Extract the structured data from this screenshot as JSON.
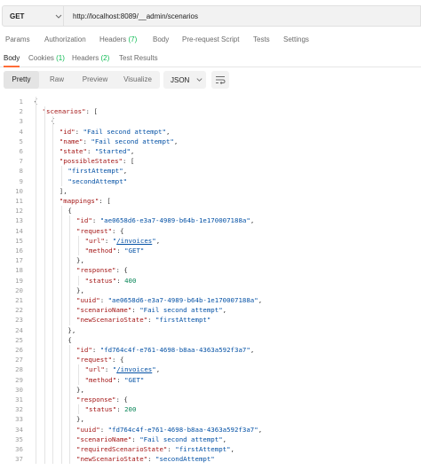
{
  "request": {
    "method": "GET",
    "url": "http://localhost:8089/__admin/scenarios"
  },
  "request_tabs": [
    {
      "label": "Params",
      "count": ""
    },
    {
      "label": "Authorization",
      "count": ""
    },
    {
      "label": "Headers",
      "count": "(7)"
    },
    {
      "label": "Body",
      "count": ""
    },
    {
      "label": "Pre-request Script",
      "count": ""
    },
    {
      "label": "Tests",
      "count": ""
    },
    {
      "label": "Settings",
      "count": ""
    }
  ],
  "response_tabs": [
    {
      "label": "Body",
      "count": "",
      "active": true
    },
    {
      "label": "Cookies",
      "count": "(1)",
      "active": false
    },
    {
      "label": "Headers",
      "count": "(2)",
      "active": false
    },
    {
      "label": "Test Results",
      "count": "",
      "active": false
    }
  ],
  "view_modes": [
    "Pretty",
    "Raw",
    "Preview",
    "Visualize"
  ],
  "active_view_mode": "Pretty",
  "format": "JSON",
  "icons": {
    "method_dropdown": "chevron-down-icon",
    "format_dropdown": "chevron-down-icon",
    "wrap": "wrap-lines-icon"
  },
  "colors": {
    "accent": "#ff6c37",
    "count": "#0cbb52",
    "key": "#a31515",
    "string": "#0451a5",
    "number": "#098658"
  },
  "code_lines": [
    [
      {
        "t": "p",
        "v": "{"
      }
    ],
    [
      {
        "t": "k",
        "v": "\"scenarios\""
      },
      {
        "t": "p",
        "v": ": ["
      }
    ],
    [
      {
        "t": "p",
        "v": "{"
      }
    ],
    [
      {
        "t": "k",
        "v": "\"id\""
      },
      {
        "t": "p",
        "v": ": "
      },
      {
        "t": "s",
        "v": "\"Fail second attempt\""
      },
      {
        "t": "p",
        "v": ","
      }
    ],
    [
      {
        "t": "k",
        "v": "\"name\""
      },
      {
        "t": "p",
        "v": ": "
      },
      {
        "t": "s",
        "v": "\"Fail second attempt\""
      },
      {
        "t": "p",
        "v": ","
      }
    ],
    [
      {
        "t": "k",
        "v": "\"state\""
      },
      {
        "t": "p",
        "v": ": "
      },
      {
        "t": "s",
        "v": "\"Started\""
      },
      {
        "t": "p",
        "v": ","
      }
    ],
    [
      {
        "t": "k",
        "v": "\"possibleStates\""
      },
      {
        "t": "p",
        "v": ": ["
      }
    ],
    [
      {
        "t": "s",
        "v": "\"firstAttempt\""
      },
      {
        "t": "p",
        "v": ","
      }
    ],
    [
      {
        "t": "s",
        "v": "\"secondAttempt\""
      }
    ],
    [
      {
        "t": "p",
        "v": "],"
      }
    ],
    [
      {
        "t": "k",
        "v": "\"mappings\""
      },
      {
        "t": "p",
        "v": ": ["
      }
    ],
    [
      {
        "t": "p",
        "v": "{"
      }
    ],
    [
      {
        "t": "k",
        "v": "\"id\""
      },
      {
        "t": "p",
        "v": ": "
      },
      {
        "t": "s",
        "v": "\"ae0658d6-e3a7-4989-b64b-1e170007188a\""
      },
      {
        "t": "p",
        "v": ","
      }
    ],
    [
      {
        "t": "k",
        "v": "\"request\""
      },
      {
        "t": "p",
        "v": ": {"
      }
    ],
    [
      {
        "t": "k",
        "v": "\"url\""
      },
      {
        "t": "p",
        "v": ": "
      },
      {
        "t": "s",
        "v": "\""
      },
      {
        "t": "su",
        "v": "/invoices"
      },
      {
        "t": "s",
        "v": "\""
      },
      {
        "t": "p",
        "v": ","
      }
    ],
    [
      {
        "t": "k",
        "v": "\"method\""
      },
      {
        "t": "p",
        "v": ": "
      },
      {
        "t": "s",
        "v": "\"GET\""
      }
    ],
    [
      {
        "t": "p",
        "v": "},"
      }
    ],
    [
      {
        "t": "k",
        "v": "\"response\""
      },
      {
        "t": "p",
        "v": ": {"
      }
    ],
    [
      {
        "t": "k",
        "v": "\"status\""
      },
      {
        "t": "p",
        "v": ": "
      },
      {
        "t": "n",
        "v": "400"
      }
    ],
    [
      {
        "t": "p",
        "v": "},"
      }
    ],
    [
      {
        "t": "k",
        "v": "\"uuid\""
      },
      {
        "t": "p",
        "v": ": "
      },
      {
        "t": "s",
        "v": "\"ae0658d6-e3a7-4989-b64b-1e170007188a\""
      },
      {
        "t": "p",
        "v": ","
      }
    ],
    [
      {
        "t": "k",
        "v": "\"scenarioName\""
      },
      {
        "t": "p",
        "v": ": "
      },
      {
        "t": "s",
        "v": "\"Fail second attempt\""
      },
      {
        "t": "p",
        "v": ","
      }
    ],
    [
      {
        "t": "k",
        "v": "\"newScenarioState\""
      },
      {
        "t": "p",
        "v": ": "
      },
      {
        "t": "s",
        "v": "\"firstAttempt\""
      }
    ],
    [
      {
        "t": "p",
        "v": "},"
      }
    ],
    [
      {
        "t": "p",
        "v": "{"
      }
    ],
    [
      {
        "t": "k",
        "v": "\"id\""
      },
      {
        "t": "p",
        "v": ": "
      },
      {
        "t": "s",
        "v": "\"fd764c4f-e761-4698-b8aa-4363a592f3a7\""
      },
      {
        "t": "p",
        "v": ","
      }
    ],
    [
      {
        "t": "k",
        "v": "\"request\""
      },
      {
        "t": "p",
        "v": ": {"
      }
    ],
    [
      {
        "t": "k",
        "v": "\"url\""
      },
      {
        "t": "p",
        "v": ": "
      },
      {
        "t": "s",
        "v": "\""
      },
      {
        "t": "su",
        "v": "/invoices"
      },
      {
        "t": "s",
        "v": "\""
      },
      {
        "t": "p",
        "v": ","
      }
    ],
    [
      {
        "t": "k",
        "v": "\"method\""
      },
      {
        "t": "p",
        "v": ": "
      },
      {
        "t": "s",
        "v": "\"GET\""
      }
    ],
    [
      {
        "t": "p",
        "v": "},"
      }
    ],
    [
      {
        "t": "k",
        "v": "\"response\""
      },
      {
        "t": "p",
        "v": ": {"
      }
    ],
    [
      {
        "t": "k",
        "v": "\"status\""
      },
      {
        "t": "p",
        "v": ": "
      },
      {
        "t": "n",
        "v": "200"
      }
    ],
    [
      {
        "t": "p",
        "v": "},"
      }
    ],
    [
      {
        "t": "k",
        "v": "\"uuid\""
      },
      {
        "t": "p",
        "v": ": "
      },
      {
        "t": "s",
        "v": "\"fd764c4f-e761-4698-b8aa-4363a592f3a7\""
      },
      {
        "t": "p",
        "v": ","
      }
    ],
    [
      {
        "t": "k",
        "v": "\"scenarioName\""
      },
      {
        "t": "p",
        "v": ": "
      },
      {
        "t": "s",
        "v": "\"Fail second attempt\""
      },
      {
        "t": "p",
        "v": ","
      }
    ],
    [
      {
        "t": "k",
        "v": "\"requiredScenarioState\""
      },
      {
        "t": "p",
        "v": ": "
      },
      {
        "t": "s",
        "v": "\"firstAttempt\""
      },
      {
        "t": "p",
        "v": ","
      }
    ],
    [
      {
        "t": "k",
        "v": "\"newScenarioState\""
      },
      {
        "t": "p",
        "v": ": "
      },
      {
        "t": "s",
        "v": "\"secondAttempt\""
      }
    ]
  ]
}
